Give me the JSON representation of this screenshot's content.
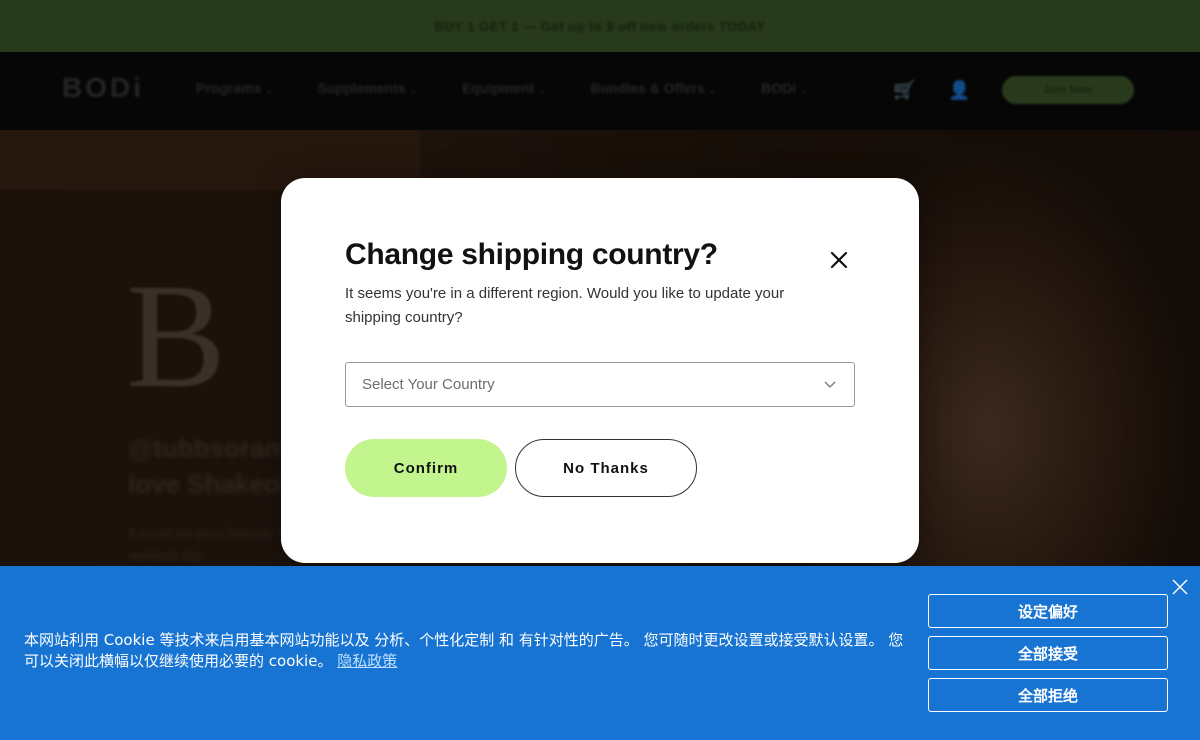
{
  "background": {
    "promo_text": "BUY 1 GET 1 — Get up to $ off new orders TODAY",
    "logo": "BODi",
    "nav_items": [
      "Programs",
      "Supplements",
      "Equipment",
      "Bundles & Offers",
      "BODi"
    ],
    "cta_label": "Join Now",
    "hero_heading": "@tubbsorama & friends love Shakeology",
    "hero_copy": "It could be your favorite fuel for the workout day"
  },
  "modal": {
    "title": "Change shipping country?",
    "description": "It seems you're in a different region. Would you like to update your shipping country?",
    "select_placeholder": "Select Your Country",
    "confirm_label": "Confirm",
    "no_thanks_label": "No Thanks",
    "close_icon": "close-icon"
  },
  "cookie_banner": {
    "text": "本网站利用 Cookie 等技术来启用基本网站功能以及 分析、个性化定制 和 有针对性的广告。 您可随时更改设置或接受默认设置。 您可以关闭此横幅以仅继续使用必要的 cookie。",
    "privacy_link": "隐私政策",
    "preferences_label": "设定偏好",
    "accept_all_label": "全部接受",
    "reject_all_label": "全部拒绝",
    "close_icon": "close-icon"
  },
  "colors": {
    "confirm_bg": "#c2f58e",
    "banner_bg": "#1874d2",
    "promo_bg": "#3d5a2a"
  }
}
